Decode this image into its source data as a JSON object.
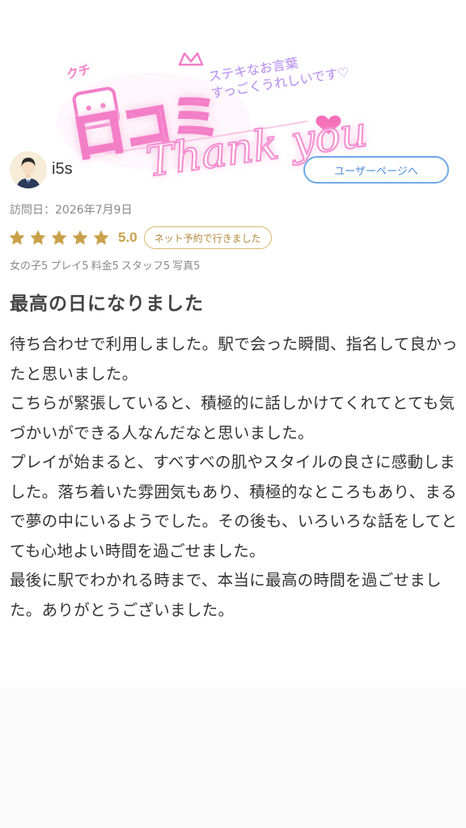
{
  "header": {
    "logo_kana": "クチ",
    "logo_main": "口コミ",
    "logo_slogan_line1": "ステキなお言葉",
    "logo_slogan_line2": "すっごくうれしいです♡",
    "logo_thanks": "Thank you"
  },
  "user": {
    "name": "i5s",
    "page_button_label": "ユーザーページへ"
  },
  "review": {
    "visit_date": "訪問日：2026年7月9日",
    "rating": {
      "stars": 5,
      "max_stars": 5,
      "score": "5.0",
      "star_color": "#c9a14a"
    },
    "reservation_badge": "ネット予約で行きました",
    "sub_scores": [
      "女の子5",
      "プレイ5",
      "料金5",
      "スタッフ5",
      "写真5"
    ],
    "title": "最高の日になりました",
    "paragraphs": [
      "待ち合わせで利用しました。駅で会った瞬間、指名して良かったと思いました。",
      "こちらが緊張していると、積極的に話しかけてくれてとても気づかいができる人なんだなと思いました。",
      "プレイが始まると、すべすべの肌やスタイルの良さに感動しました。落ち着いた雰囲気もあり、積極的なところもあり、まるで夢の中にいるようでした。その後も、いろいろな話をしてとても心地よい時間を過ごせました。",
      "最後に駅でわかれる時まで、本当に最高の時間を過ごせました。ありがとうございました。"
    ]
  },
  "colors": {
    "accent_pink": "#f37ec8",
    "button_blue": "#6ea8e6",
    "gold": "#c9a14a"
  },
  "icons": {
    "avatar": "user-avatar-icon",
    "star": "star-icon"
  }
}
